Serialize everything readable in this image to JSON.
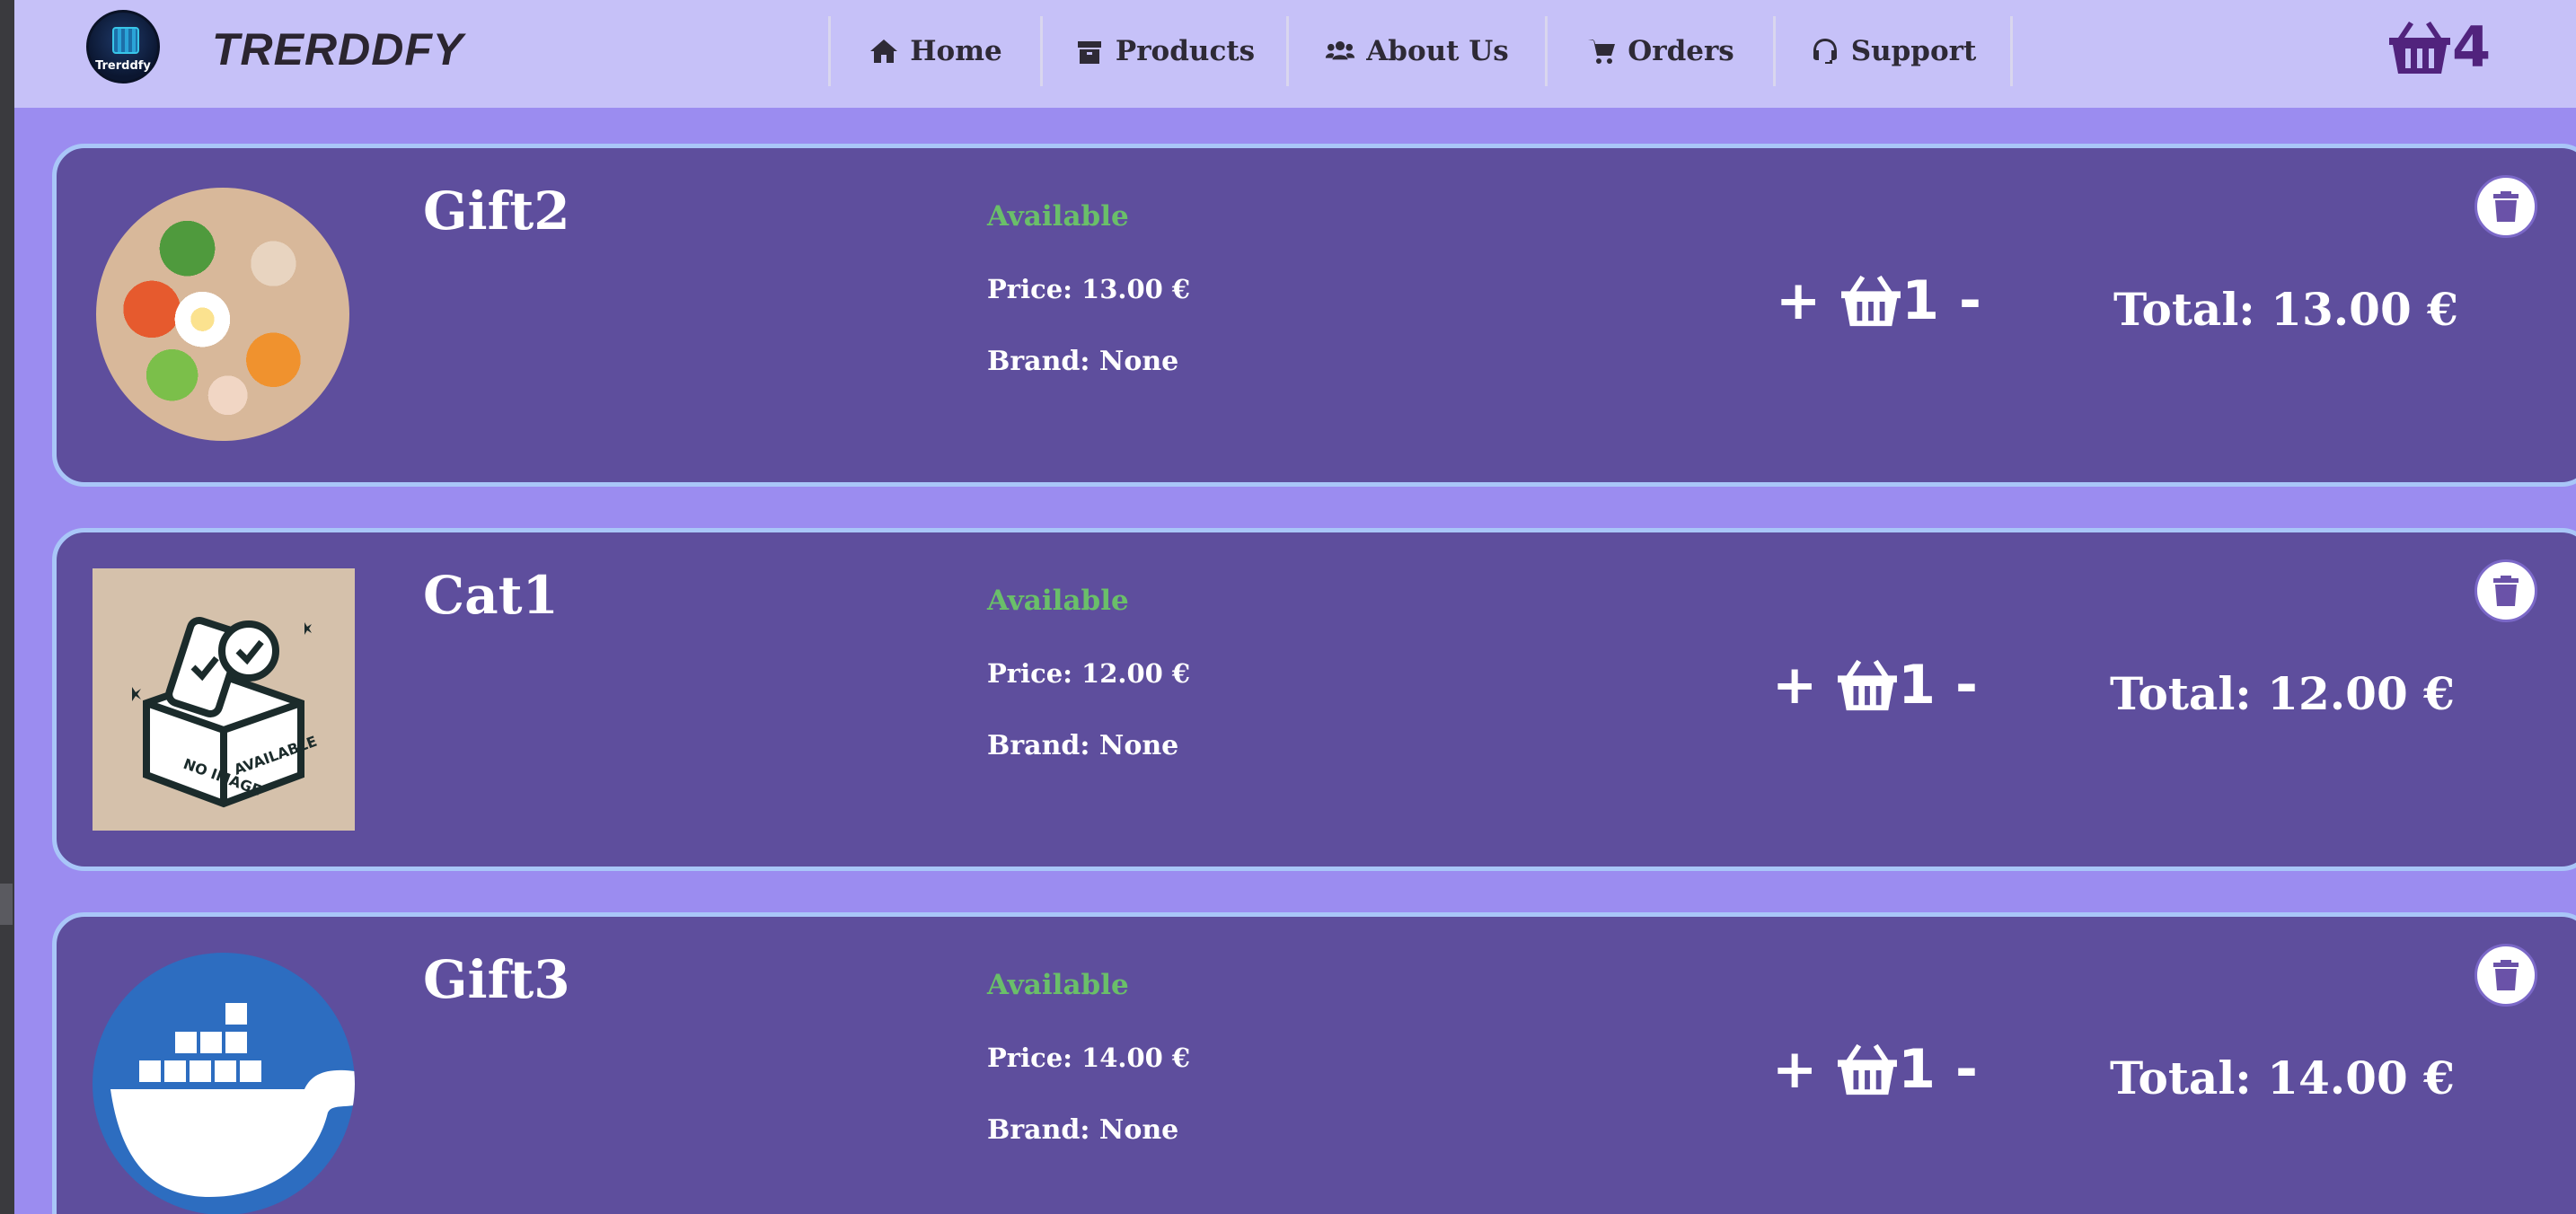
{
  "navbar": {
    "logo_text": "Trerddfy",
    "brand": "TRERDDFY",
    "items": [
      {
        "label": "Home",
        "icon": "home-icon"
      },
      {
        "label": "Products",
        "icon": "box-icon"
      },
      {
        "label": "About Us",
        "icon": "users-icon"
      },
      {
        "label": "Orders",
        "icon": "cart-icon"
      },
      {
        "label": "Support",
        "icon": "headset-icon"
      }
    ],
    "cart_count": "4"
  },
  "cart_items": [
    {
      "name": "Gift2",
      "status": "Available",
      "price": "Price: 13.00 €",
      "brand": "Brand: None",
      "quantity": "1",
      "total": "Total: 13.00 €",
      "image": "bowl-food-image"
    },
    {
      "name": "Cat1",
      "status": "Available",
      "price": "Price: 12.00 €",
      "brand": "Brand: None",
      "quantity": "1",
      "total": "Total: 12.00 €",
      "image": "no-image-available-placeholder"
    },
    {
      "name": "Gift3",
      "status": "Available",
      "price": "Price: 14.00 €",
      "brand": "Brand: None",
      "quantity": "1",
      "total": "Total: 14.00 €",
      "image": "docker-whale-logo"
    }
  ],
  "placeholder_image_text": {
    "line1": "NO IMAGE",
    "line2": "AVAILABLE"
  },
  "colors": {
    "page_bg": "#9b8cf0",
    "navbar_bg": "#c6c1f8",
    "card_bg": "#5e4e9d",
    "card_border": "#a9c6f8",
    "status_available": "#6abf69",
    "cart_badge": "#51237d"
  }
}
